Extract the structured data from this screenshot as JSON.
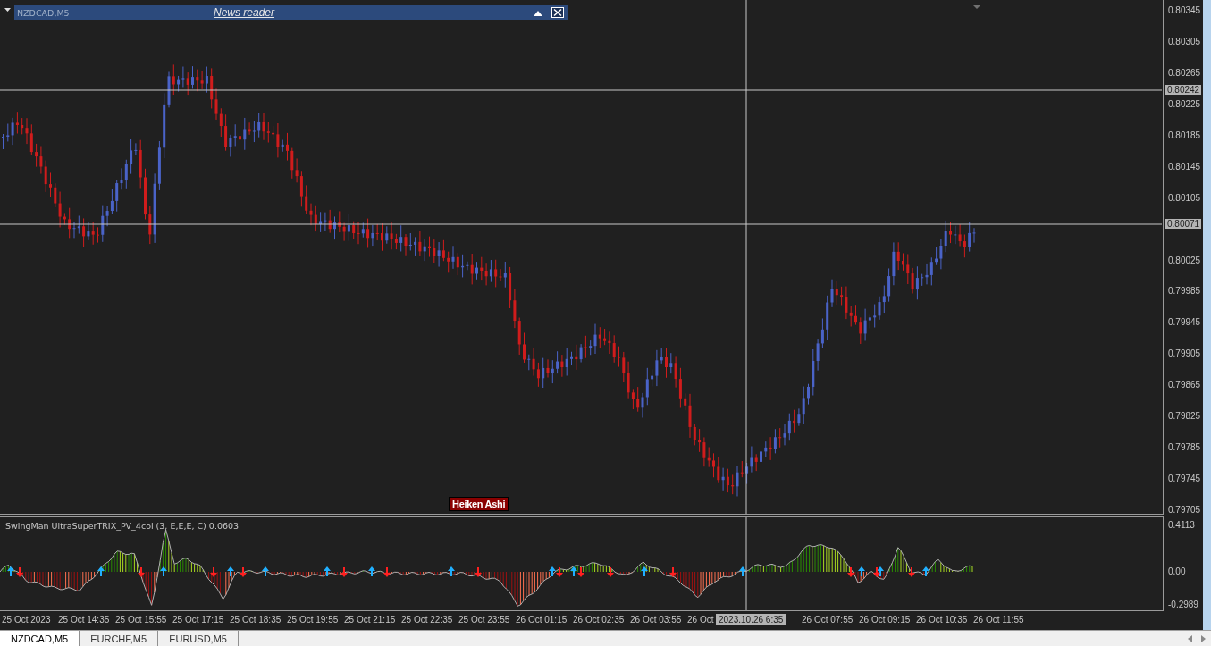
{
  "chart_header": {
    "symbol": "NZDCAD,M5",
    "panel_title": "News reader"
  },
  "price_axis": {
    "ticks": [
      "0.80345",
      "0.80305",
      "0.80265",
      "0.80225",
      "0.80185",
      "0.80145",
      "0.80105",
      "0.80025",
      "0.79985",
      "0.79945",
      "0.79905",
      "0.79865",
      "0.79825",
      "0.79785",
      "0.79745",
      "0.79705"
    ],
    "markers": [
      "0.80242",
      "0.80071"
    ]
  },
  "chart_label": "Heiken Ashi",
  "indicator": {
    "title": "SwingMan UltraSuperTRIX_PV_4col (3, E,E,E, C) 0.0603",
    "ticks": [
      "0.4113",
      "0.00",
      "-0.2989"
    ]
  },
  "time_axis": {
    "ticks": [
      "25 Oct 2023",
      "25 Oct 14:35",
      "25 Oct 15:55",
      "25 Oct 17:15",
      "25 Oct 18:35",
      "25 Oct 19:55",
      "25 Oct 21:15",
      "25 Oct 22:35",
      "25 Oct 23:55",
      "26 Oct 01:15",
      "26 Oct 02:35",
      "26 Oct 03:55",
      "26 Oct",
      "26 Oct 07:55",
      "26 Oct 09:15",
      "26 Oct 10:35",
      "26 Oct 11:55"
    ],
    "cursor_label": "2023.10.26 6:35"
  },
  "tabs": [
    {
      "label": "NZDCAD,M5",
      "selected": true
    },
    {
      "label": "EURCHF,M5",
      "selected": false
    },
    {
      "label": "EURUSD,M5",
      "selected": false
    }
  ]
}
